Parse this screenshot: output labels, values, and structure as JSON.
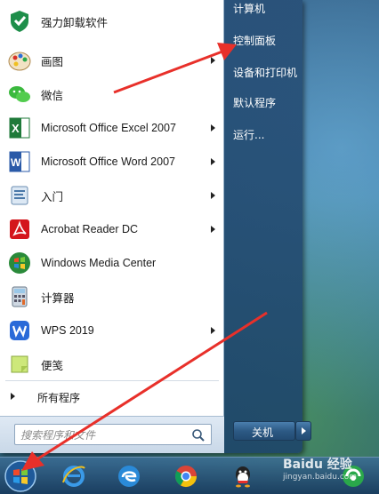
{
  "start_menu": {
    "programs": [
      {
        "label": "强力卸载软件",
        "icon": "uninstaller-icon",
        "has_submenu": false
      },
      {
        "label": "画图",
        "icon": "paint-icon",
        "has_submenu": true
      },
      {
        "label": "微信",
        "icon": "wechat-icon",
        "has_submenu": false
      },
      {
        "label": "Microsoft Office Excel 2007",
        "icon": "excel-icon",
        "has_submenu": true
      },
      {
        "label": "Microsoft Office Word 2007",
        "icon": "word-icon",
        "has_submenu": true
      },
      {
        "label": "入门",
        "icon": "getting-started-icon",
        "has_submenu": true
      },
      {
        "label": "Acrobat Reader DC",
        "icon": "acrobat-icon",
        "has_submenu": true
      },
      {
        "label": "Windows Media Center",
        "icon": "media-center-icon",
        "has_submenu": false
      },
      {
        "label": "计算器",
        "icon": "calculator-icon",
        "has_submenu": false
      },
      {
        "label": "WPS 2019",
        "icon": "wps-icon",
        "has_submenu": true
      },
      {
        "label": "便笺",
        "icon": "sticky-notes-icon",
        "has_submenu": false
      }
    ],
    "all_programs_label": "所有程序",
    "search_placeholder": "搜索程序和文件",
    "right_items": [
      {
        "label": "计算机"
      },
      {
        "label": "控制面板"
      },
      {
        "label": "设备和打印机"
      },
      {
        "label": "默认程序"
      },
      {
        "label": "运行..."
      }
    ],
    "shutdown_label": "关机"
  },
  "taskbar": {
    "icons": [
      "start-orb-icon",
      "internet-explorer-icon",
      "edge-icon",
      "chrome-icon",
      "qq-icon",
      "360-browser-icon"
    ]
  },
  "watermark": {
    "text": "Baidu 经验",
    "sub": "jingyan.baidu.com"
  },
  "colors": {
    "arrow": "#e8302a",
    "menu_blue": "#2d5a85"
  }
}
